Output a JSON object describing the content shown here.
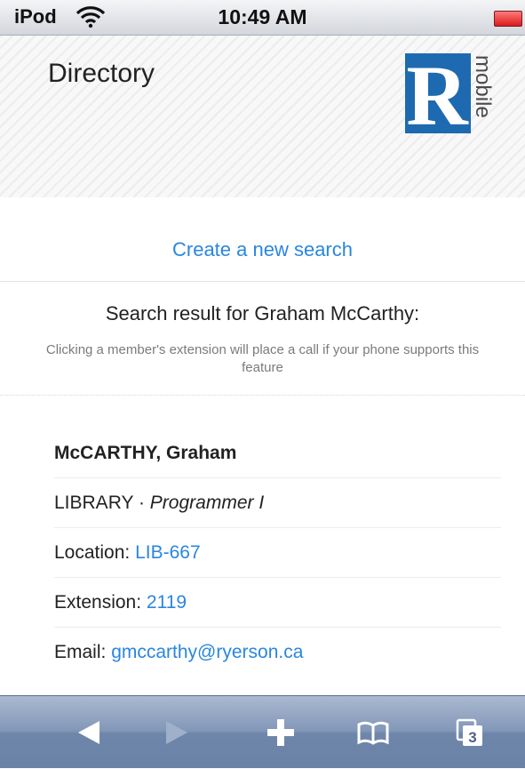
{
  "status_bar": {
    "carrier": "iPod",
    "time": "10:49 AM",
    "wifi_icon": "wifi-icon",
    "battery_icon": "battery-low-icon",
    "battery_color": "#d91c1c"
  },
  "header": {
    "title": "Directory",
    "logo_letter": "R",
    "logo_word": "mobile",
    "logo_color": "#1e6ab0"
  },
  "search": {
    "new_search_link": "Create a new search",
    "result_heading": "Search result for Graham McCarthy:",
    "note": "Clicking a member's extension will place a call if your phone supports this feature"
  },
  "member": {
    "name": "McCARTHY, Graham",
    "department": "LIBRARY",
    "separator": "·",
    "position": "Programmer I",
    "location_label": "Location:",
    "location_value": "LIB-667",
    "extension_label": "Extension:",
    "extension_value": "2119",
    "email_label": "Email:",
    "email_value": "gmccarthy@ryerson.ca"
  },
  "toolbar": {
    "back_icon": "back-arrow-icon",
    "forward_icon": "forward-arrow-icon",
    "add_icon": "plus-icon",
    "bookmarks_icon": "bookmarks-book-icon",
    "pages_icon": "pages-icon",
    "pages_count": "3"
  },
  "colors": {
    "link": "#2a86e0",
    "toolbar": "#7d93b6"
  }
}
